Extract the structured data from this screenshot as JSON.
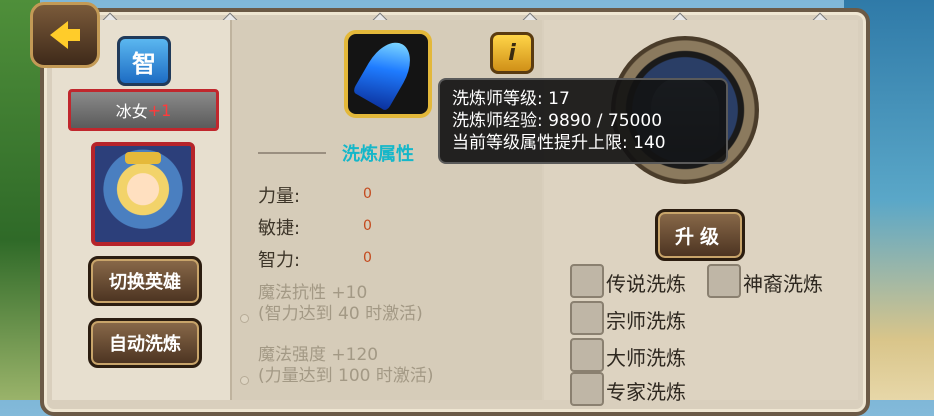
{
  "hero": {
    "attribute_glyph": "智",
    "name": "冰女",
    "plus": "+1"
  },
  "left_buttons": {
    "switch_hero": "切换英雄",
    "auto_refine": "自动洗炼"
  },
  "section": {
    "title": "洗炼属性"
  },
  "stats": [
    {
      "label": "力量:",
      "value": "0"
    },
    {
      "label": "敏捷:",
      "value": "0"
    },
    {
      "label": "智力:",
      "value": "0"
    }
  ],
  "bonuses": [
    {
      "line1": "魔法抗性 +10",
      "line2": "(智力达到 40 时激活)"
    },
    {
      "line1": "魔法强度 +120",
      "line2": "(力量达到 100 时激活)"
    }
  ],
  "tooltip": {
    "line1": "洗炼师等级: 17",
    "line2": "洗炼师经验: 9890 / 75000",
    "line3": "当前等级属性提升上限: 140"
  },
  "upgrade_label": "升级",
  "info_glyph": "i",
  "refine_options": [
    {
      "label": "传说洗炼"
    },
    {
      "label": "神裔洗炼"
    },
    {
      "label": "宗师洗炼"
    },
    {
      "label": "大师洗炼"
    },
    {
      "label": "专家洗炼"
    }
  ],
  "colors": {
    "section_title": "#15b7c9",
    "stat_value": "#c44a1e",
    "name_frame": "#c0272d",
    "gold_frame": "#e3b83a"
  }
}
